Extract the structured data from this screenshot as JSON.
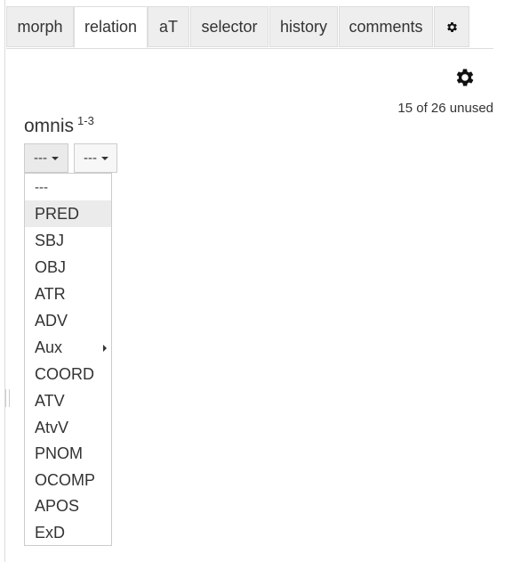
{
  "tabs": [
    {
      "label": "morph"
    },
    {
      "label": "relation"
    },
    {
      "label": "aT"
    },
    {
      "label": "selector"
    },
    {
      "label": "history"
    },
    {
      "label": "comments"
    }
  ],
  "active_tab": "relation",
  "status": {
    "unused": "15 of 26 unused"
  },
  "word": {
    "form": "omnis",
    "ref": "1-3"
  },
  "dropdowns": {
    "relation_value": "---",
    "aux_value": "---"
  },
  "menu": {
    "items": [
      {
        "label": "---"
      },
      {
        "label": "PRED"
      },
      {
        "label": "SBJ"
      },
      {
        "label": "OBJ"
      },
      {
        "label": "ATR"
      },
      {
        "label": "ADV"
      },
      {
        "label": "Aux"
      },
      {
        "label": "COORD"
      },
      {
        "label": "ATV"
      },
      {
        "label": "AtvV"
      },
      {
        "label": "PNOM"
      },
      {
        "label": "OCOMP"
      },
      {
        "label": "APOS"
      },
      {
        "label": "ExD"
      }
    ],
    "highlighted": "PRED"
  },
  "icons": {
    "tab_settings": "gear-icon",
    "panel_settings": "gear-icon"
  }
}
